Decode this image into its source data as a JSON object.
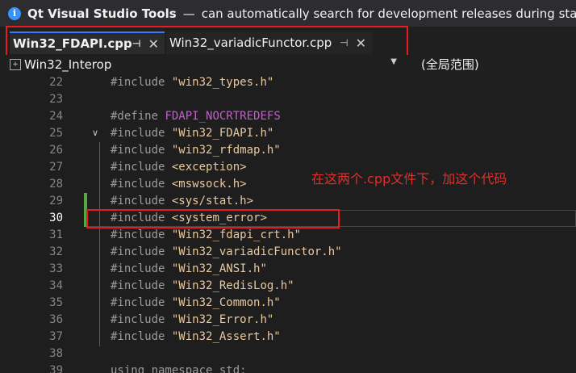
{
  "infobar": {
    "title": "Qt Visual Studio Tools",
    "separator": "—",
    "message": "can automatically search for development releases during startup."
  },
  "tabs": [
    {
      "label": "Win32_FDAPI.cpp",
      "pin": "⊣",
      "close": "✕",
      "active": true
    },
    {
      "label": "Win32_variadicFunctor.cpp",
      "pin": "⊣",
      "close": "✕",
      "active": false
    }
  ],
  "navbar": {
    "scope": "Win32_Interop",
    "member": "(全局范围)"
  },
  "annotation": "在这两个.cpp文件下，加这个代码",
  "lines": [
    {
      "n": "22",
      "kw": "#include",
      "arg": "\"win32_types.h\"",
      "type": "str"
    },
    {
      "n": "23",
      "kw": "",
      "arg": "",
      "type": "str"
    },
    {
      "n": "24",
      "kw": "#define",
      "arg": "FDAPI_NOCRTREDEFS",
      "type": "macro"
    },
    {
      "n": "25",
      "kw": "#include",
      "arg": "\"Win32_FDAPI.h\"",
      "type": "str"
    },
    {
      "n": "26",
      "kw": "#include",
      "arg": "\"win32_rfdmap.h\"",
      "type": "str"
    },
    {
      "n": "27",
      "kw": "#include",
      "arg": "<exception>",
      "type": "ang"
    },
    {
      "n": "28",
      "kw": "#include",
      "arg": "<mswsock.h>",
      "type": "ang"
    },
    {
      "n": "29",
      "kw": "#include",
      "arg": "<sys/stat.h>",
      "type": "ang"
    },
    {
      "n": "30",
      "kw": "#include",
      "arg": "<system_error>",
      "type": "ang"
    },
    {
      "n": "31",
      "kw": "#include",
      "arg": "\"Win32_fdapi_crt.h\"",
      "type": "str"
    },
    {
      "n": "32",
      "kw": "#include",
      "arg": "\"Win32_variadicFunctor.h\"",
      "type": "str"
    },
    {
      "n": "33",
      "kw": "#include",
      "arg": "\"Win32_ANSI.h\"",
      "type": "str"
    },
    {
      "n": "34",
      "kw": "#include",
      "arg": "\"Win32_RedisLog.h\"",
      "type": "str"
    },
    {
      "n": "35",
      "kw": "#include",
      "arg": "\"Win32_Common.h\"",
      "type": "str"
    },
    {
      "n": "36",
      "kw": "#include",
      "arg": "\"Win32_Error.h\"",
      "type": "str"
    },
    {
      "n": "37",
      "kw": "#include",
      "arg": "\"Win32_Assert.h\"",
      "type": "str"
    },
    {
      "n": "38",
      "kw": "",
      "arg": "",
      "type": "str"
    },
    {
      "n": "39",
      "kw": "using namespace std;",
      "arg": "",
      "type": "str"
    }
  ],
  "current_line": "30",
  "fold_symbol": "∨",
  "colors": {
    "accent": "#3b78ff",
    "annotation_red": "#e81b24",
    "change_bar": "#57a64a"
  }
}
